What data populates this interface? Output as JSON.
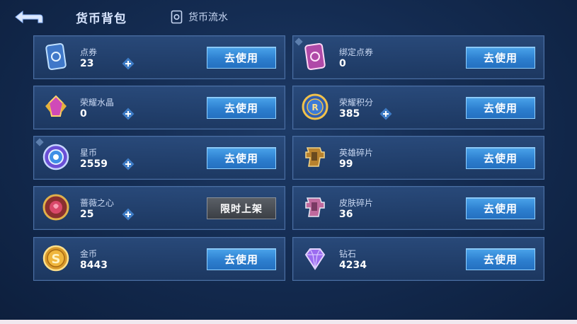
{
  "header": {
    "title": "货币背包",
    "flow_label": "货币流水"
  },
  "use_label": "去使用",
  "limited_label": "限时上架",
  "colors": {
    "accent": "#2d7fcf",
    "card_border": "#4a6fa3",
    "background": "#142c52"
  },
  "left_cards": [
    {
      "name": "点券",
      "count": "23",
      "icon": "coupon-icon"
    },
    {
      "name": "荣耀水晶",
      "count": "0",
      "icon": "glory-crystal-icon"
    },
    {
      "name": "星币",
      "count": "2559",
      "icon": "star-coin-icon"
    },
    {
      "name": "蔷薇之心",
      "count": "25",
      "icon": "rose-heart-icon"
    },
    {
      "name": "金币",
      "count": "8443",
      "icon": "gold-coin-icon"
    }
  ],
  "right_cards": [
    {
      "name": "绑定点券",
      "count": "0",
      "icon": "bound-coupon-icon"
    },
    {
      "name": "荣耀积分",
      "count": "385",
      "icon": "glory-points-icon"
    },
    {
      "name": "英雄碎片",
      "count": "99",
      "icon": "hero-fragment-icon"
    },
    {
      "name": "皮肤碎片",
      "count": "36",
      "icon": "skin-fragment-icon"
    },
    {
      "name": "钻石",
      "count": "4234",
      "icon": "diamond-icon"
    }
  ]
}
